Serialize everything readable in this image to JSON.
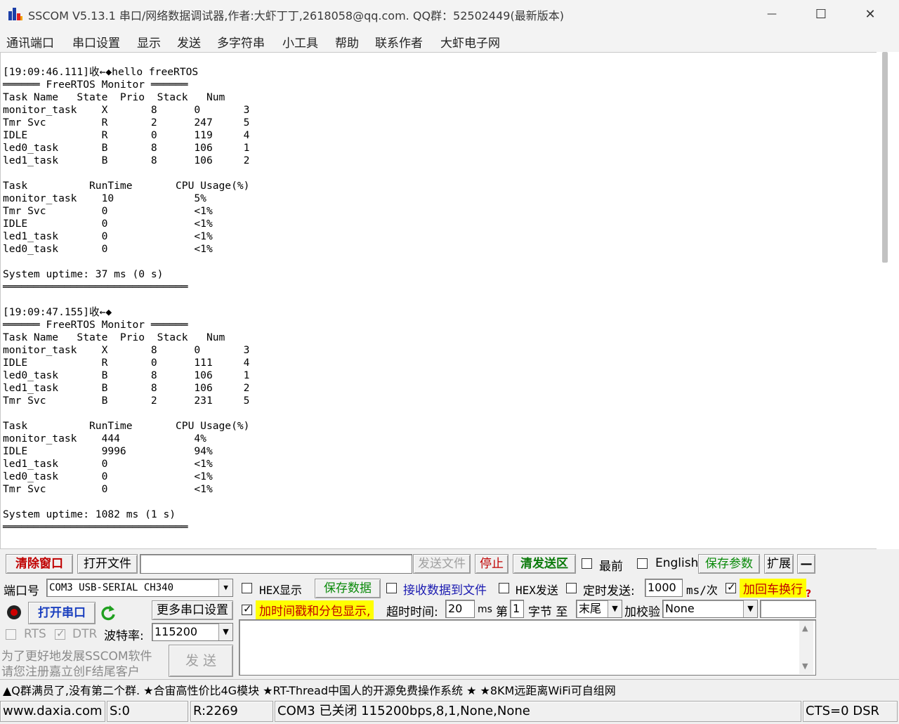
{
  "window": {
    "title": "SSCOM V5.13.1 串口/网络数据调试器,作者:大虾丁丁,2618058@qq.com. QQ群：52502449(最新版本)",
    "minimize_glyph": "—",
    "maximize_glyph": "☐",
    "close_glyph": "✕"
  },
  "menu": [
    "通讯端口",
    "串口设置",
    "显示",
    "发送",
    "多字符串",
    "小工具",
    "帮助",
    "联系作者",
    "大虾电子网"
  ],
  "receive": {
    "lines": [
      "[19:09:46.111]收←◆hello freeRTOS",
      "══════ FreeRTOS Monitor ══════",
      "Task Name   State  Prio  Stack   Num",
      "monitor_task    X       8      0       3",
      "Tmr Svc         R       2      247     5",
      "IDLE            R       0      119     4",
      "led0_task       B       8      106     1",
      "led1_task       B       8      106     2",
      "",
      "Task          RunTime       CPU Usage(%)",
      "monitor_task    10             5%",
      "Tmr Svc         0              <1%",
      "IDLE            0              <1%",
      "led1_task       0              <1%",
      "led0_task       0              <1%",
      "",
      "System uptime: 37 ms (0 s)",
      "══════════════════════════════",
      "",
      "[19:09:47.155]收←◆",
      "══════ FreeRTOS Monitor ══════",
      "Task Name   State  Prio  Stack   Num",
      "monitor_task    X       8      0       3",
      "IDLE            R       0      111     4",
      "led0_task       B       8      106     1",
      "led1_task       B       8      106     2",
      "Tmr Svc         B       2      231     5",
      "",
      "Task          RunTime       CPU Usage(%)",
      "monitor_task    444            4%",
      "IDLE            9996           94%",
      "led1_task       0              <1%",
      "led0_task       0              <1%",
      "Tmr Svc         0              <1%",
      "",
      "System uptime: 1082 ms (1 s)",
      "══════════════════════════════"
    ]
  },
  "toolbar": {
    "clear_window": "清除窗口",
    "open_file": "打开文件",
    "file_path": "",
    "send_file": "发送文件",
    "stop": "停止",
    "clear_send": "清发送区",
    "topmost": "最前",
    "english": "English",
    "save_params": "保存参数",
    "expand": "扩展",
    "collapse": "—"
  },
  "port": {
    "port_label": "端口号",
    "port_value": "COM3 USB-SERIAL CH340",
    "open_port": "打开串口",
    "more_settings": "更多串口设置",
    "rts": "RTS",
    "dtr": "DTR",
    "baud_label": "波特率:",
    "baud_value": "115200",
    "promo_line1": "为了更好地发展SSCOM软件",
    "promo_line2": "请您注册嘉立创F结尾客户",
    "send_button": "发 送"
  },
  "options": {
    "hex_display": "HEX显示",
    "save_data": "保存数据",
    "recv_to_file": "接收数据到文件",
    "hex_send": "HEX发送",
    "timed_send": "定时发送:",
    "interval_value": "1000",
    "interval_unit": "ms/次",
    "add_crlf": "加回车换行",
    "timestamp": "加时间戳和分包显示,",
    "timeout_label": "超时时间:",
    "timeout_value": "20",
    "timeout_unit": "ms",
    "nth_label": "第",
    "nth_value": "1",
    "byte_label": "字节 至",
    "end_value": "末尾",
    "checksum_label": "加校验",
    "checksum_value": "None",
    "help_glyph": "?"
  },
  "send_area": {
    "text": ""
  },
  "ticker": "▲Q群满员了,没有第二个群. ★合宙高性价比4G模块 ★RT-Thread中国人的开源免费操作系统 ★ ★8KM远距离WiFi可自组网",
  "statusbar": {
    "website": "www.daxia.com",
    "sent": "S:0",
    "received": "R:2269",
    "port_status": "COM3 已关闭  115200bps,8,1,None,None",
    "lines": "CTS=0 DSR"
  },
  "colors": {
    "clear_window_text": "#c00000",
    "open_port_text": "#1a3fbf",
    "save_data_text": "#0a8a0a",
    "recv_file_text": "#1a1ab0",
    "stop_text": "#c00000",
    "clear_send_text": "#0a7a0a",
    "save_params_text": "#0a8a0a",
    "highlight": "#ffff00",
    "highlight_text": "#c00000"
  }
}
